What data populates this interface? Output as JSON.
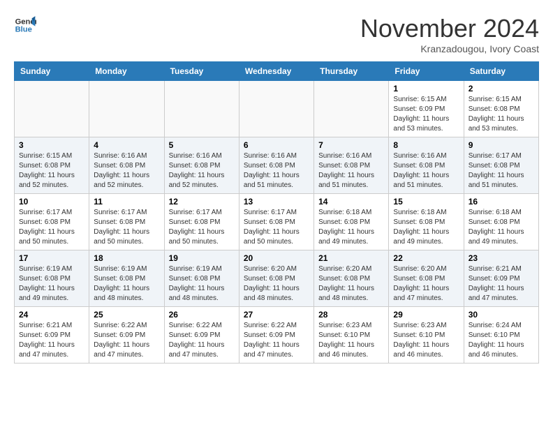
{
  "header": {
    "logo_line1": "General",
    "logo_line2": "Blue",
    "month": "November 2024",
    "location": "Kranzadougou, Ivory Coast"
  },
  "days_of_week": [
    "Sunday",
    "Monday",
    "Tuesday",
    "Wednesday",
    "Thursday",
    "Friday",
    "Saturday"
  ],
  "weeks": [
    [
      {
        "day": "",
        "info": ""
      },
      {
        "day": "",
        "info": ""
      },
      {
        "day": "",
        "info": ""
      },
      {
        "day": "",
        "info": ""
      },
      {
        "day": "",
        "info": ""
      },
      {
        "day": "1",
        "info": "Sunrise: 6:15 AM\nSunset: 6:09 PM\nDaylight: 11 hours\nand 53 minutes."
      },
      {
        "day": "2",
        "info": "Sunrise: 6:15 AM\nSunset: 6:08 PM\nDaylight: 11 hours\nand 53 minutes."
      }
    ],
    [
      {
        "day": "3",
        "info": "Sunrise: 6:15 AM\nSunset: 6:08 PM\nDaylight: 11 hours\nand 52 minutes."
      },
      {
        "day": "4",
        "info": "Sunrise: 6:16 AM\nSunset: 6:08 PM\nDaylight: 11 hours\nand 52 minutes."
      },
      {
        "day": "5",
        "info": "Sunrise: 6:16 AM\nSunset: 6:08 PM\nDaylight: 11 hours\nand 52 minutes."
      },
      {
        "day": "6",
        "info": "Sunrise: 6:16 AM\nSunset: 6:08 PM\nDaylight: 11 hours\nand 51 minutes."
      },
      {
        "day": "7",
        "info": "Sunrise: 6:16 AM\nSunset: 6:08 PM\nDaylight: 11 hours\nand 51 minutes."
      },
      {
        "day": "8",
        "info": "Sunrise: 6:16 AM\nSunset: 6:08 PM\nDaylight: 11 hours\nand 51 minutes."
      },
      {
        "day": "9",
        "info": "Sunrise: 6:17 AM\nSunset: 6:08 PM\nDaylight: 11 hours\nand 51 minutes."
      }
    ],
    [
      {
        "day": "10",
        "info": "Sunrise: 6:17 AM\nSunset: 6:08 PM\nDaylight: 11 hours\nand 50 minutes."
      },
      {
        "day": "11",
        "info": "Sunrise: 6:17 AM\nSunset: 6:08 PM\nDaylight: 11 hours\nand 50 minutes."
      },
      {
        "day": "12",
        "info": "Sunrise: 6:17 AM\nSunset: 6:08 PM\nDaylight: 11 hours\nand 50 minutes."
      },
      {
        "day": "13",
        "info": "Sunrise: 6:17 AM\nSunset: 6:08 PM\nDaylight: 11 hours\nand 50 minutes."
      },
      {
        "day": "14",
        "info": "Sunrise: 6:18 AM\nSunset: 6:08 PM\nDaylight: 11 hours\nand 49 minutes."
      },
      {
        "day": "15",
        "info": "Sunrise: 6:18 AM\nSunset: 6:08 PM\nDaylight: 11 hours\nand 49 minutes."
      },
      {
        "day": "16",
        "info": "Sunrise: 6:18 AM\nSunset: 6:08 PM\nDaylight: 11 hours\nand 49 minutes."
      }
    ],
    [
      {
        "day": "17",
        "info": "Sunrise: 6:19 AM\nSunset: 6:08 PM\nDaylight: 11 hours\nand 49 minutes."
      },
      {
        "day": "18",
        "info": "Sunrise: 6:19 AM\nSunset: 6:08 PM\nDaylight: 11 hours\nand 48 minutes."
      },
      {
        "day": "19",
        "info": "Sunrise: 6:19 AM\nSunset: 6:08 PM\nDaylight: 11 hours\nand 48 minutes."
      },
      {
        "day": "20",
        "info": "Sunrise: 6:20 AM\nSunset: 6:08 PM\nDaylight: 11 hours\nand 48 minutes."
      },
      {
        "day": "21",
        "info": "Sunrise: 6:20 AM\nSunset: 6:08 PM\nDaylight: 11 hours\nand 48 minutes."
      },
      {
        "day": "22",
        "info": "Sunrise: 6:20 AM\nSunset: 6:08 PM\nDaylight: 11 hours\nand 47 minutes."
      },
      {
        "day": "23",
        "info": "Sunrise: 6:21 AM\nSunset: 6:09 PM\nDaylight: 11 hours\nand 47 minutes."
      }
    ],
    [
      {
        "day": "24",
        "info": "Sunrise: 6:21 AM\nSunset: 6:09 PM\nDaylight: 11 hours\nand 47 minutes."
      },
      {
        "day": "25",
        "info": "Sunrise: 6:22 AM\nSunset: 6:09 PM\nDaylight: 11 hours\nand 47 minutes."
      },
      {
        "day": "26",
        "info": "Sunrise: 6:22 AM\nSunset: 6:09 PM\nDaylight: 11 hours\nand 47 minutes."
      },
      {
        "day": "27",
        "info": "Sunrise: 6:22 AM\nSunset: 6:09 PM\nDaylight: 11 hours\nand 47 minutes."
      },
      {
        "day": "28",
        "info": "Sunrise: 6:23 AM\nSunset: 6:10 PM\nDaylight: 11 hours\nand 46 minutes."
      },
      {
        "day": "29",
        "info": "Sunrise: 6:23 AM\nSunset: 6:10 PM\nDaylight: 11 hours\nand 46 minutes."
      },
      {
        "day": "30",
        "info": "Sunrise: 6:24 AM\nSunset: 6:10 PM\nDaylight: 11 hours\nand 46 minutes."
      }
    ]
  ]
}
